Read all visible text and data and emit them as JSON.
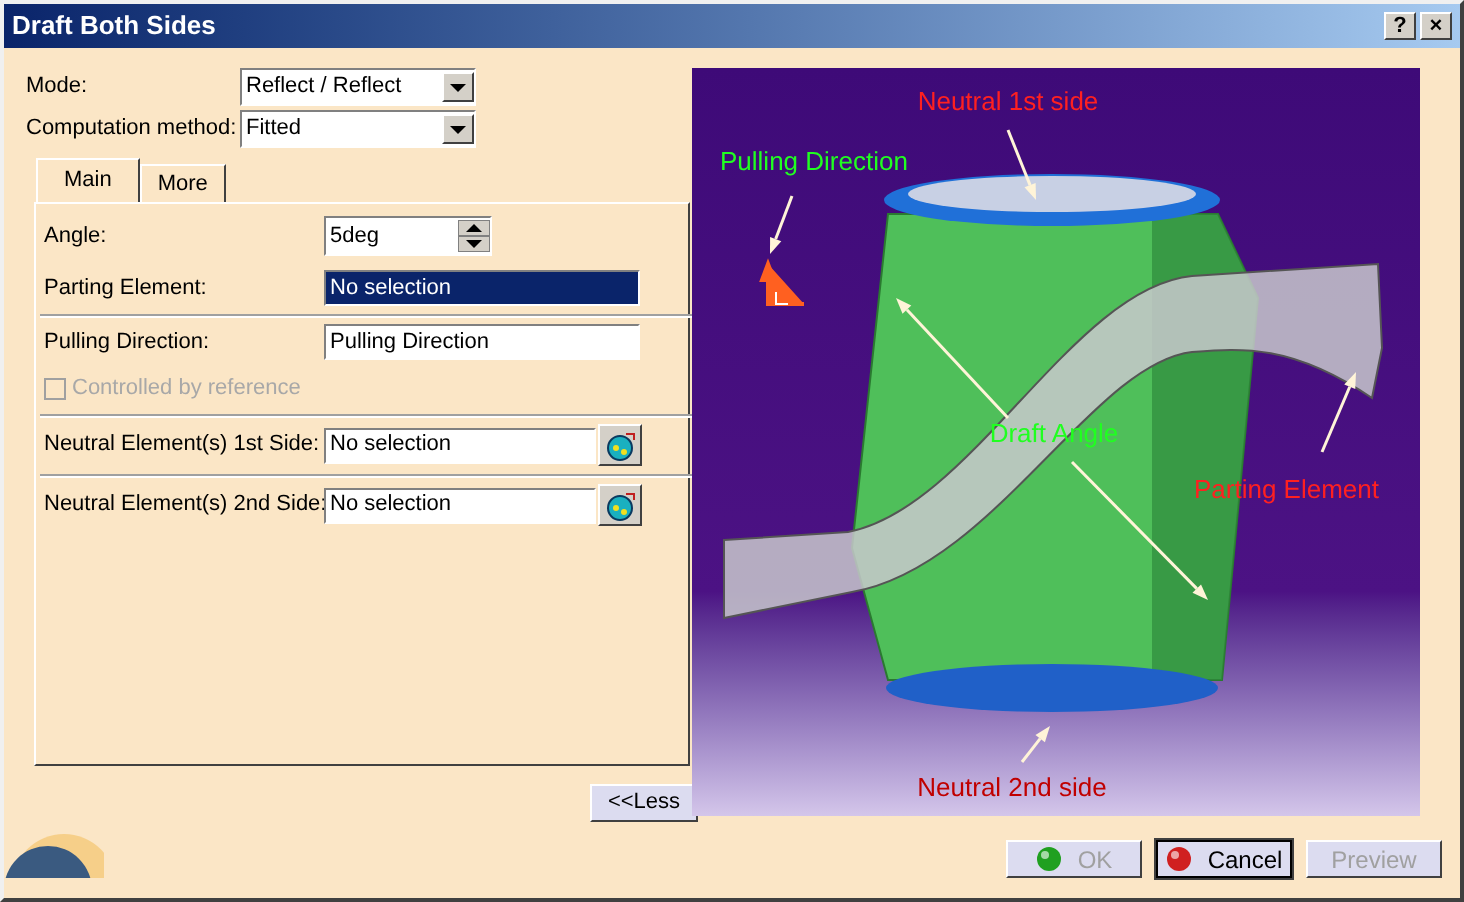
{
  "window": {
    "title": "Draft Both Sides",
    "title_buttons": [
      "?",
      "×"
    ]
  },
  "fields": [
    {
      "label": "Mode:",
      "value": "Reflect / Reflect"
    },
    {
      "label": "Computation method:",
      "value": "Fitted"
    }
  ],
  "tabs": [
    {
      "label": "Main",
      "selected": true
    },
    {
      "label": "More",
      "selected": false
    }
  ],
  "main": {
    "angle": {
      "label": "Angle:",
      "value": "5deg"
    },
    "rows": [
      {
        "kind": "field",
        "label": "Parting Element:",
        "value": "No selection",
        "selected": true
      },
      {
        "kind": "field",
        "label": "Pulling Direction:",
        "value": "Pulling Direction",
        "selected": false
      },
      {
        "kind": "checkbox",
        "label": "Controlled by reference",
        "checked": false,
        "disabled": true
      },
      {
        "kind": "picker",
        "label": "Neutral Element(s) 1st Side:",
        "value": "No selection",
        "selected": false
      },
      {
        "kind": "picker",
        "label": "Neutral Element(s) 2nd Side:",
        "value": "No selection",
        "selected": false
      }
    ]
  },
  "less_button": "<<Less",
  "figure_labels": [
    {
      "text": "Neutral 1st side",
      "color": "#ff2020"
    },
    {
      "text": "Pulling Direction",
      "color": "#20ff20"
    },
    {
      "text": "Draft Angle",
      "color": "#20ff20"
    },
    {
      "text": "Parting Element",
      "color": "#ff2020"
    },
    {
      "text": "Neutral 2nd side",
      "color": "#c00000"
    }
  ],
  "buttons": [
    {
      "label": "OK",
      "kind": "ok",
      "disabled": true,
      "default": false
    },
    {
      "label": "Cancel",
      "kind": "cancel",
      "disabled": false,
      "default": true
    },
    {
      "label": "Preview",
      "kind": "plain",
      "disabled": true,
      "default": false
    }
  ]
}
